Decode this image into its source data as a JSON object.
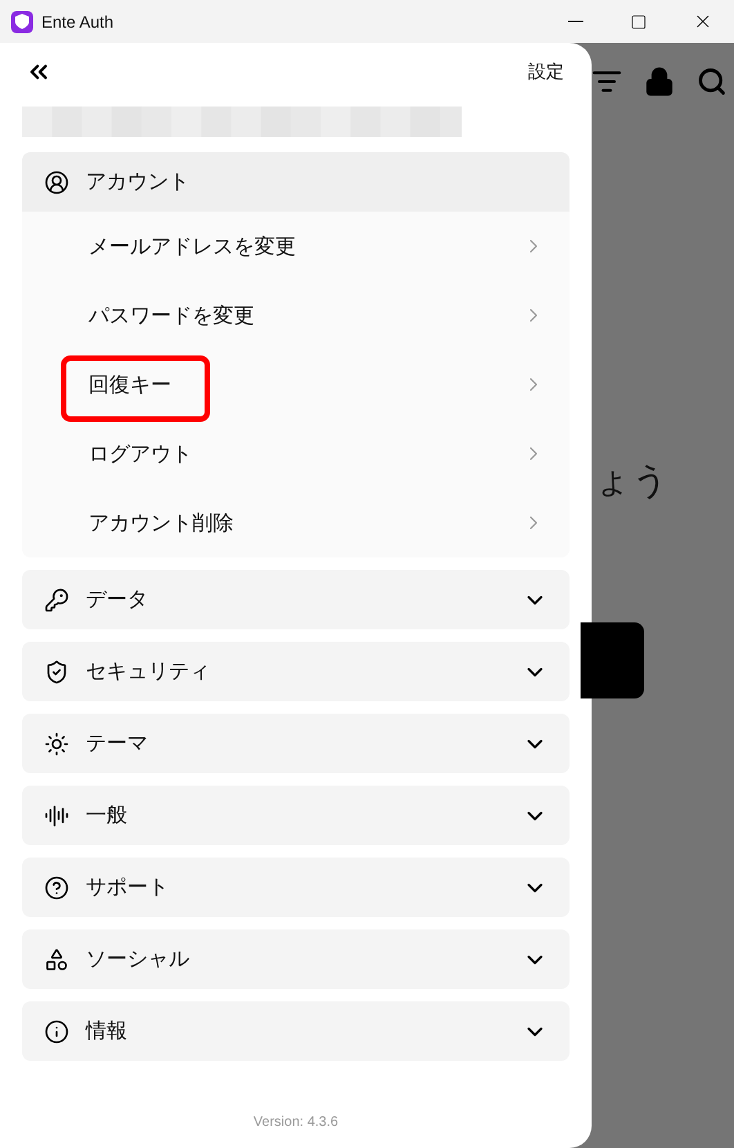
{
  "window": {
    "title": "Ente Auth"
  },
  "background": {
    "heading_fragment": "ょう"
  },
  "drawer": {
    "title": "設定",
    "sections": [
      {
        "kind": "account",
        "label": "アカウント",
        "expanded": true,
        "items": [
          {
            "label": "メールアドレスを変更",
            "highlighted": false
          },
          {
            "label": "パスワードを変更",
            "highlighted": false
          },
          {
            "label": "回復キー",
            "highlighted": true
          },
          {
            "label": "ログアウト",
            "highlighted": false
          },
          {
            "label": "アカウント削除",
            "highlighted": false
          }
        ]
      },
      {
        "kind": "key",
        "label": "データ",
        "expanded": false
      },
      {
        "kind": "shield",
        "label": "セキュリティ",
        "expanded": false
      },
      {
        "kind": "sun",
        "label": "テーマ",
        "expanded": false
      },
      {
        "kind": "audio",
        "label": "一般",
        "expanded": false
      },
      {
        "kind": "help",
        "label": "サポート",
        "expanded": false
      },
      {
        "kind": "shapes",
        "label": "ソーシャル",
        "expanded": false
      },
      {
        "kind": "info",
        "label": "情報",
        "expanded": false
      }
    ],
    "version": "Version: 4.3.6"
  }
}
